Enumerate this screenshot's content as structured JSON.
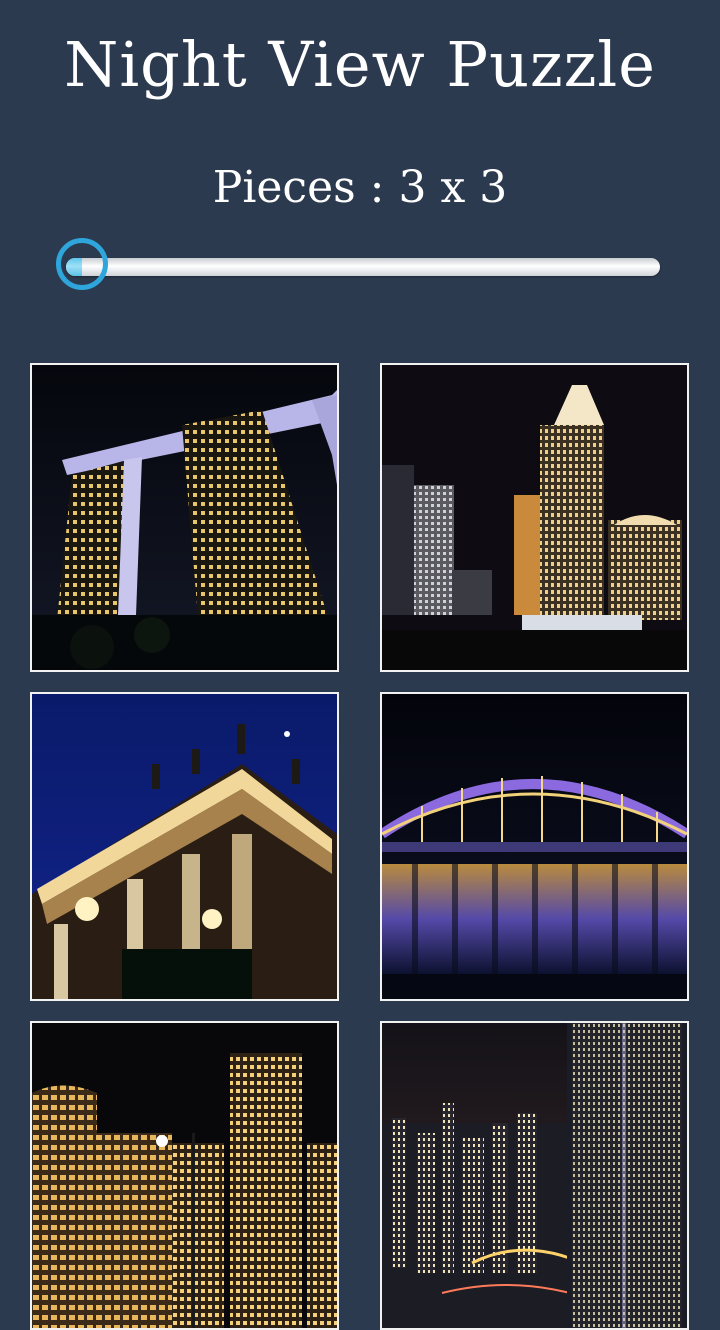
{
  "title": "Night View Puzzle",
  "pieces": {
    "label": "Pieces : 3 x 3",
    "min": 3,
    "max": 10,
    "value": 3
  },
  "colors": {
    "background": "#2c3a4f",
    "accent": "#2ea6dc",
    "tile_border": "#f2f2f2"
  },
  "gallery": [
    {
      "name": "sky-hotel-towers"
    },
    {
      "name": "skyscraper-skyline"
    },
    {
      "name": "opera-house-columns"
    },
    {
      "name": "arch-bridge-reflection"
    },
    {
      "name": "tower-street-night"
    },
    {
      "name": "city-panorama-night"
    }
  ]
}
